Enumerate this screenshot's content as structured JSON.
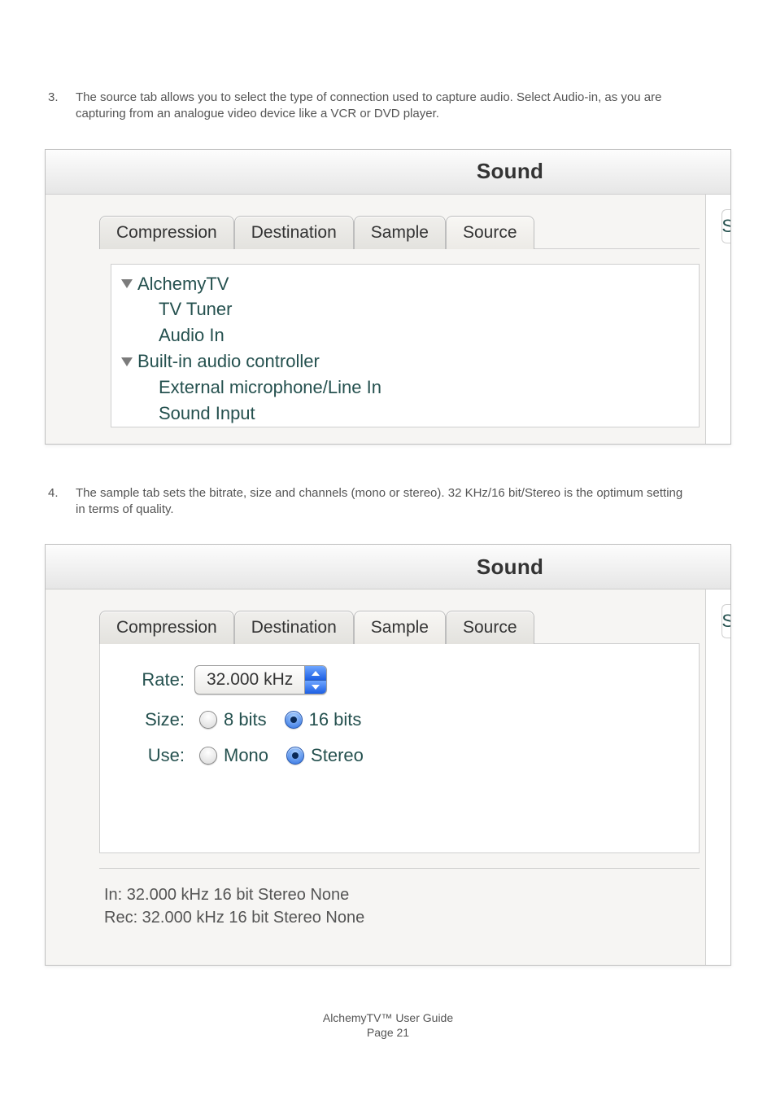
{
  "steps": [
    {
      "number": "3.",
      "text": "The source tab allows you to select the type  of connection used to capture audio. Select Audio-in, as you are capturing from an analogue video device like a VCR or DVD player."
    },
    {
      "number": "4.",
      "text": "The sample tab sets the bitrate, size and channels (mono or stereo). 32 KHz/16 bit/Stereo is the optimum setting in terms of quality."
    }
  ],
  "sourcePanel": {
    "title": "Sound",
    "rightLetter": "S",
    "tabs": [
      "Compression",
      "Destination",
      "Sample",
      "Source"
    ],
    "activeTabIndex": 3,
    "tree": [
      {
        "label": "AlchemyTV",
        "children": [
          "TV Tuner",
          "Audio In"
        ]
      },
      {
        "label": "Built-in audio controller",
        "children": [
          "External microphone/Line In",
          "Sound Input"
        ]
      }
    ]
  },
  "samplePanel": {
    "title": "Sound",
    "rightLetter": "S",
    "tabs": [
      "Compression",
      "Destination",
      "Sample",
      "Source"
    ],
    "activeTabIndex": 2,
    "form": {
      "rate": {
        "label": "Rate:",
        "value": "32.000 kHz"
      },
      "size": {
        "label": "Size:",
        "options": [
          "8 bits",
          "16 bits"
        ],
        "selectedIndex": 1
      },
      "use": {
        "label": "Use:",
        "options": [
          "Mono",
          "Stereo"
        ],
        "selectedIndex": 1
      }
    },
    "status": [
      "In: 32.000 kHz 16 bit Stereo None",
      "Rec: 32.000 kHz 16 bit Stereo None"
    ]
  },
  "footer": {
    "line1": "AlchemyTV™ User Guide",
    "pageLabel": "Page ",
    "pageNumber": "21"
  }
}
